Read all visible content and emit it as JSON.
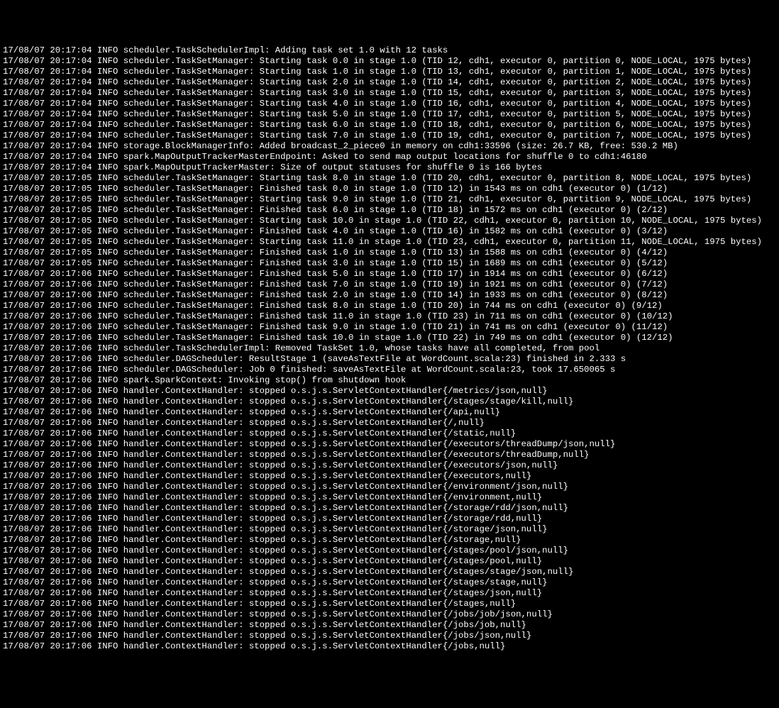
{
  "log_lines": [
    "17/08/07 20:17:04 INFO scheduler.TaskSchedulerImpl: Adding task set 1.0 with 12 tasks",
    "17/08/07 20:17:04 INFO scheduler.TaskSetManager: Starting task 0.0 in stage 1.0 (TID 12, cdh1, executor 0, partition 0, NODE_LOCAL, 1975 bytes)",
    "17/08/07 20:17:04 INFO scheduler.TaskSetManager: Starting task 1.0 in stage 1.0 (TID 13, cdh1, executor 0, partition 1, NODE_LOCAL, 1975 bytes)",
    "17/08/07 20:17:04 INFO scheduler.TaskSetManager: Starting task 2.0 in stage 1.0 (TID 14, cdh1, executor 0, partition 2, NODE_LOCAL, 1975 bytes)",
    "17/08/07 20:17:04 INFO scheduler.TaskSetManager: Starting task 3.0 in stage 1.0 (TID 15, cdh1, executor 0, partition 3, NODE_LOCAL, 1975 bytes)",
    "17/08/07 20:17:04 INFO scheduler.TaskSetManager: Starting task 4.0 in stage 1.0 (TID 16, cdh1, executor 0, partition 4, NODE_LOCAL, 1975 bytes)",
    "17/08/07 20:17:04 INFO scheduler.TaskSetManager: Starting task 5.0 in stage 1.0 (TID 17, cdh1, executor 0, partition 5, NODE_LOCAL, 1975 bytes)",
    "17/08/07 20:17:04 INFO scheduler.TaskSetManager: Starting task 6.0 in stage 1.0 (TID 18, cdh1, executor 0, partition 6, NODE_LOCAL, 1975 bytes)",
    "17/08/07 20:17:04 INFO scheduler.TaskSetManager: Starting task 7.0 in stage 1.0 (TID 19, cdh1, executor 0, partition 7, NODE_LOCAL, 1975 bytes)",
    "17/08/07 20:17:04 INFO storage.BlockManagerInfo: Added broadcast_2_piece0 in memory on cdh1:33596 (size: 26.7 KB, free: 530.2 MB)",
    "17/08/07 20:17:04 INFO spark.MapOutputTrackerMasterEndpoint: Asked to send map output locations for shuffle 0 to cdh1:46180",
    "17/08/07 20:17:04 INFO spark.MapOutputTrackerMaster: Size of output statuses for shuffle 0 is 166 bytes",
    "17/08/07 20:17:05 INFO scheduler.TaskSetManager: Starting task 8.0 in stage 1.0 (TID 20, cdh1, executor 0, partition 8, NODE_LOCAL, 1975 bytes)",
    "17/08/07 20:17:05 INFO scheduler.TaskSetManager: Finished task 0.0 in stage 1.0 (TID 12) in 1543 ms on cdh1 (executor 0) (1/12)",
    "17/08/07 20:17:05 INFO scheduler.TaskSetManager: Starting task 9.0 in stage 1.0 (TID 21, cdh1, executor 0, partition 9, NODE_LOCAL, 1975 bytes)",
    "17/08/07 20:17:05 INFO scheduler.TaskSetManager: Finished task 6.0 in stage 1.0 (TID 18) in 1572 ms on cdh1 (executor 0) (2/12)",
    "17/08/07 20:17:05 INFO scheduler.TaskSetManager: Starting task 10.0 in stage 1.0 (TID 22, cdh1, executor 0, partition 10, NODE_LOCAL, 1975 bytes)",
    "17/08/07 20:17:05 INFO scheduler.TaskSetManager: Finished task 4.0 in stage 1.0 (TID 16) in 1582 ms on cdh1 (executor 0) (3/12)",
    "17/08/07 20:17:05 INFO scheduler.TaskSetManager: Starting task 11.0 in stage 1.0 (TID 23, cdh1, executor 0, partition 11, NODE_LOCAL, 1975 bytes)",
    "17/08/07 20:17:05 INFO scheduler.TaskSetManager: Finished task 1.0 in stage 1.0 (TID 13) in 1588 ms on cdh1 (executor 0) (4/12)",
    "17/08/07 20:17:05 INFO scheduler.TaskSetManager: Finished task 3.0 in stage 1.0 (TID 15) in 1689 ms on cdh1 (executor 0) (5/12)",
    "17/08/07 20:17:06 INFO scheduler.TaskSetManager: Finished task 5.0 in stage 1.0 (TID 17) in 1914 ms on cdh1 (executor 0) (6/12)",
    "17/08/07 20:17:06 INFO scheduler.TaskSetManager: Finished task 7.0 in stage 1.0 (TID 19) in 1921 ms on cdh1 (executor 0) (7/12)",
    "17/08/07 20:17:06 INFO scheduler.TaskSetManager: Finished task 2.0 in stage 1.0 (TID 14) in 1933 ms on cdh1 (executor 0) (8/12)",
    "17/08/07 20:17:06 INFO scheduler.TaskSetManager: Finished task 8.0 in stage 1.0 (TID 20) in 744 ms on cdh1 (executor 0) (9/12)",
    "17/08/07 20:17:06 INFO scheduler.TaskSetManager: Finished task 11.0 in stage 1.0 (TID 23) in 711 ms on cdh1 (executor 0) (10/12)",
    "17/08/07 20:17:06 INFO scheduler.TaskSetManager: Finished task 9.0 in stage 1.0 (TID 21) in 741 ms on cdh1 (executor 0) (11/12)",
    "17/08/07 20:17:06 INFO scheduler.TaskSetManager: Finished task 10.0 in stage 1.0 (TID 22) in 749 ms on cdh1 (executor 0) (12/12)",
    "17/08/07 20:17:06 INFO scheduler.TaskSchedulerImpl: Removed TaskSet 1.0, whose tasks have all completed, from pool",
    "17/08/07 20:17:06 INFO scheduler.DAGScheduler: ResultStage 1 (saveAsTextFile at WordCount.scala:23) finished in 2.333 s",
    "17/08/07 20:17:06 INFO scheduler.DAGScheduler: Job 0 finished: saveAsTextFile at WordCount.scala:23, took 17.650065 s",
    "17/08/07 20:17:06 INFO spark.SparkContext: Invoking stop() from shutdown hook",
    "17/08/07 20:17:06 INFO handler.ContextHandler: stopped o.s.j.s.ServletContextHandler{/metrics/json,null}",
    "17/08/07 20:17:06 INFO handler.ContextHandler: stopped o.s.j.s.ServletContextHandler{/stages/stage/kill,null}",
    "17/08/07 20:17:06 INFO handler.ContextHandler: stopped o.s.j.s.ServletContextHandler{/api,null}",
    "17/08/07 20:17:06 INFO handler.ContextHandler: stopped o.s.j.s.ServletContextHandler{/,null}",
    "17/08/07 20:17:06 INFO handler.ContextHandler: stopped o.s.j.s.ServletContextHandler{/static,null}",
    "17/08/07 20:17:06 INFO handler.ContextHandler: stopped o.s.j.s.ServletContextHandler{/executors/threadDump/json,null}",
    "17/08/07 20:17:06 INFO handler.ContextHandler: stopped o.s.j.s.ServletContextHandler{/executors/threadDump,null}",
    "17/08/07 20:17:06 INFO handler.ContextHandler: stopped o.s.j.s.ServletContextHandler{/executors/json,null}",
    "17/08/07 20:17:06 INFO handler.ContextHandler: stopped o.s.j.s.ServletContextHandler{/executors,null}",
    "17/08/07 20:17:06 INFO handler.ContextHandler: stopped o.s.j.s.ServletContextHandler{/environment/json,null}",
    "17/08/07 20:17:06 INFO handler.ContextHandler: stopped o.s.j.s.ServletContextHandler{/environment,null}",
    "17/08/07 20:17:06 INFO handler.ContextHandler: stopped o.s.j.s.ServletContextHandler{/storage/rdd/json,null}",
    "17/08/07 20:17:06 INFO handler.ContextHandler: stopped o.s.j.s.ServletContextHandler{/storage/rdd,null}",
    "17/08/07 20:17:06 INFO handler.ContextHandler: stopped o.s.j.s.ServletContextHandler{/storage/json,null}",
    "17/08/07 20:17:06 INFO handler.ContextHandler: stopped o.s.j.s.ServletContextHandler{/storage,null}",
    "17/08/07 20:17:06 INFO handler.ContextHandler: stopped o.s.j.s.ServletContextHandler{/stages/pool/json,null}",
    "17/08/07 20:17:06 INFO handler.ContextHandler: stopped o.s.j.s.ServletContextHandler{/stages/pool,null}",
    "17/08/07 20:17:06 INFO handler.ContextHandler: stopped o.s.j.s.ServletContextHandler{/stages/stage/json,null}",
    "17/08/07 20:17:06 INFO handler.ContextHandler: stopped o.s.j.s.ServletContextHandler{/stages/stage,null}",
    "17/08/07 20:17:06 INFO handler.ContextHandler: stopped o.s.j.s.ServletContextHandler{/stages/json,null}",
    "17/08/07 20:17:06 INFO handler.ContextHandler: stopped o.s.j.s.ServletContextHandler{/stages,null}",
    "17/08/07 20:17:06 INFO handler.ContextHandler: stopped o.s.j.s.ServletContextHandler{/jobs/job/json,null}",
    "17/08/07 20:17:06 INFO handler.ContextHandler: stopped o.s.j.s.ServletContextHandler{/jobs/job,null}",
    "17/08/07 20:17:06 INFO handler.ContextHandler: stopped o.s.j.s.ServletContextHandler{/jobs/json,null}",
    "17/08/07 20:17:06 INFO handler.ContextHandler: stopped o.s.j.s.ServletContextHandler{/jobs,null}"
  ]
}
